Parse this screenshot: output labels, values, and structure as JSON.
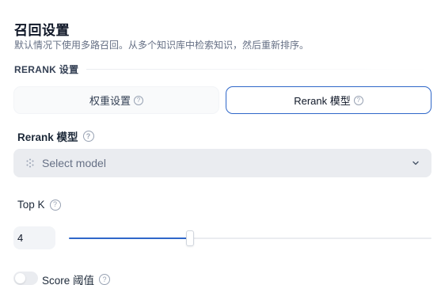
{
  "header": {
    "title": "召回设置",
    "subtitle": "默认情况下使用多路召回。从多个知识库中检索知识，然后重新排序。"
  },
  "section": {
    "label": "RERANK 设置"
  },
  "tabs": [
    {
      "label": "权重设置",
      "icon": "help-circle-icon",
      "active": false
    },
    {
      "label": "Rerank 模型",
      "icon": "help-circle-icon",
      "active": true
    }
  ],
  "rerank_model": {
    "label": "Rerank 模型",
    "placeholder": "Select model",
    "icon": "cube-icon"
  },
  "top_k": {
    "label": "Top K",
    "value": "4",
    "slider_fraction": 0.335
  },
  "score_threshold": {
    "label": "Score 阈值",
    "enabled": false
  },
  "colors": {
    "accent": "#2f67c9",
    "select_bg": "#eaecf0"
  }
}
